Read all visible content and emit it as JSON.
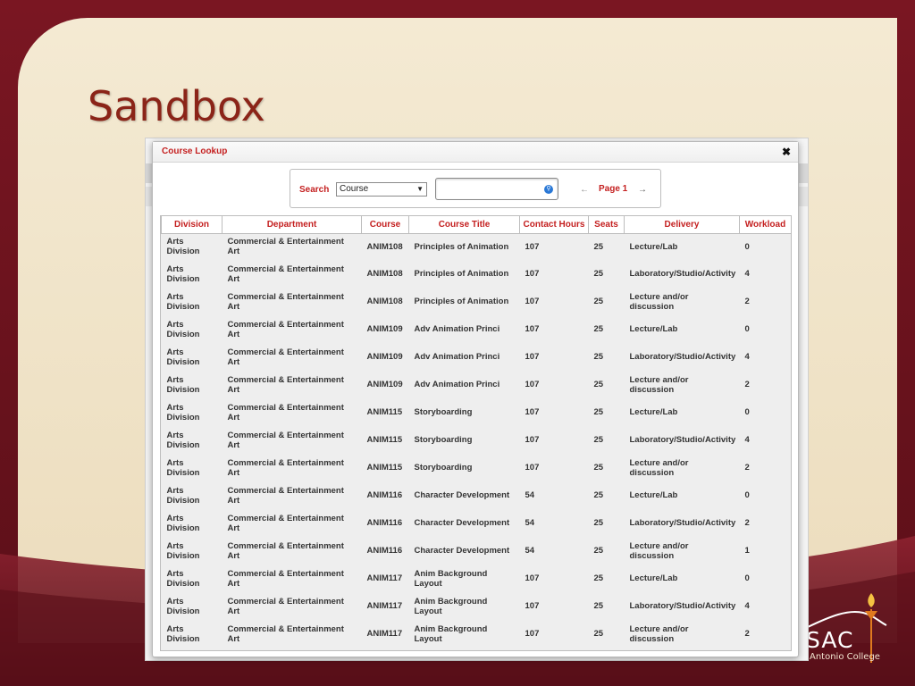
{
  "slide": {
    "title": "Sandbox",
    "logo_text": "SAC",
    "logo_subtext": "Antonio College"
  },
  "modal": {
    "title": "Course Lookup",
    "close_label": "✖"
  },
  "search": {
    "label": "Search",
    "select_value": "Course",
    "input_value": "",
    "prev_label": "←",
    "page_label": "Page 1",
    "next_label": "→"
  },
  "table": {
    "headers": [
      "Division",
      "Department",
      "Course",
      "Course Title",
      "Contact Hours",
      "Seats",
      "Delivery",
      "Workload"
    ],
    "rows": [
      [
        "Arts Division",
        "Commercial & Entertainment Art",
        "ANIM108",
        "Principles of Animation",
        "107",
        "25",
        "Lecture/Lab",
        "0"
      ],
      [
        "Arts Division",
        "Commercial & Entertainment Art",
        "ANIM108",
        "Principles of Animation",
        "107",
        "25",
        "Laboratory/Studio/Activity",
        "4"
      ],
      [
        "Arts Division",
        "Commercial & Entertainment Art",
        "ANIM108",
        "Principles of Animation",
        "107",
        "25",
        "Lecture and/or discussion",
        "2"
      ],
      [
        "Arts Division",
        "Commercial & Entertainment Art",
        "ANIM109",
        "Adv Animation Princi",
        "107",
        "25",
        "Lecture/Lab",
        "0"
      ],
      [
        "Arts Division",
        "Commercial & Entertainment Art",
        "ANIM109",
        "Adv Animation Princi",
        "107",
        "25",
        "Laboratory/Studio/Activity",
        "4"
      ],
      [
        "Arts Division",
        "Commercial & Entertainment Art",
        "ANIM109",
        "Adv Animation Princi",
        "107",
        "25",
        "Lecture and/or discussion",
        "2"
      ],
      [
        "Arts Division",
        "Commercial & Entertainment Art",
        "ANIM115",
        "Storyboarding",
        "107",
        "25",
        "Lecture/Lab",
        "0"
      ],
      [
        "Arts Division",
        "Commercial & Entertainment Art",
        "ANIM115",
        "Storyboarding",
        "107",
        "25",
        "Laboratory/Studio/Activity",
        "4"
      ],
      [
        "Arts Division",
        "Commercial & Entertainment Art",
        "ANIM115",
        "Storyboarding",
        "107",
        "25",
        "Lecture and/or discussion",
        "2"
      ],
      [
        "Arts Division",
        "Commercial & Entertainment Art",
        "ANIM116",
        "Character Development",
        "54",
        "25",
        "Lecture/Lab",
        "0"
      ],
      [
        "Arts Division",
        "Commercial & Entertainment Art",
        "ANIM116",
        "Character Development",
        "54",
        "25",
        "Laboratory/Studio/Activity",
        "2"
      ],
      [
        "Arts Division",
        "Commercial & Entertainment Art",
        "ANIM116",
        "Character Development",
        "54",
        "25",
        "Lecture and/or discussion",
        "1"
      ],
      [
        "Arts Division",
        "Commercial & Entertainment Art",
        "ANIM117",
        "Anim Background Layout",
        "107",
        "25",
        "Lecture/Lab",
        "0"
      ],
      [
        "Arts Division",
        "Commercial & Entertainment Art",
        "ANIM117",
        "Anim Background Layout",
        "107",
        "25",
        "Laboratory/Studio/Activity",
        "4"
      ],
      [
        "Arts Division",
        "Commercial & Entertainment Art",
        "ANIM117",
        "Anim Background Layout",
        "107",
        "25",
        "Lecture and/or discussion",
        "2"
      ]
    ]
  },
  "colors": {
    "accent_red": "#c41f1f",
    "slide_title": "#8b2418",
    "slide_bg": "#6a1420",
    "card_bg": "#f4ead3"
  }
}
